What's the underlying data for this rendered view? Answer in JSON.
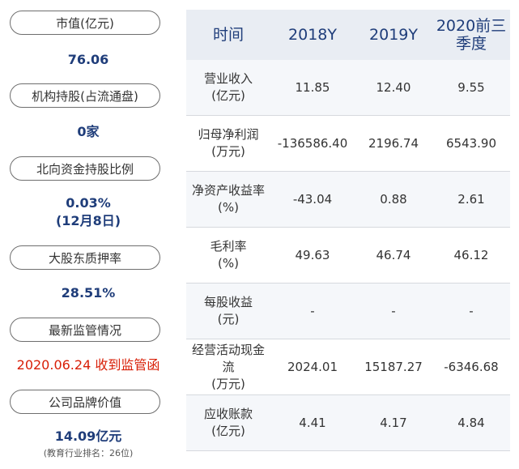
{
  "left_panel": {
    "items": [
      {
        "label": "市值(亿元)",
        "value": "76.06"
      },
      {
        "label": "机构持股(占流通盘)",
        "value": "0家"
      },
      {
        "label": "北向资金持股比例",
        "value": "0.03%",
        "value2": "(12月8日)"
      },
      {
        "label": "大股东质押率",
        "value": "28.51%"
      },
      {
        "label": "最新监管情况",
        "value": "2020.06.24 收到监管函"
      },
      {
        "label": "公司品牌价值",
        "value": "14.09亿元",
        "note": "(教育行业排名：26位)"
      }
    ]
  },
  "table": {
    "headers": [
      "时间",
      "2018Y",
      "2019Y",
      "2020前三季度"
    ],
    "rows": [
      {
        "label": "营业收入",
        "unit": "(亿元)",
        "values": [
          "11.85",
          "12.40",
          "9.55"
        ]
      },
      {
        "label": "归母净利润",
        "unit": "(万元)",
        "values": [
          "-136586.40",
          "2196.74",
          "6543.90"
        ]
      },
      {
        "label": "净资产收益率",
        "unit": "(%)",
        "values": [
          "-43.04",
          "0.88",
          "2.61"
        ]
      },
      {
        "label": "毛利率",
        "unit": "(%)",
        "values": [
          "49.63",
          "46.74",
          "46.12"
        ]
      },
      {
        "label": "每股收益",
        "unit": "(元)",
        "values": [
          "-",
          "-",
          "-"
        ]
      },
      {
        "label": "经营活动现金流",
        "unit": "(万元)",
        "values": [
          "2024.01",
          "15187.27",
          "-6346.68"
        ]
      },
      {
        "label": "应收账款",
        "unit": "(亿元)",
        "values": [
          "4.41",
          "4.17",
          "4.84"
        ]
      }
    ]
  },
  "colors": {
    "accent": "#1f3d7a",
    "alert": "#d81e06",
    "header_bg": "#e9edf3"
  }
}
